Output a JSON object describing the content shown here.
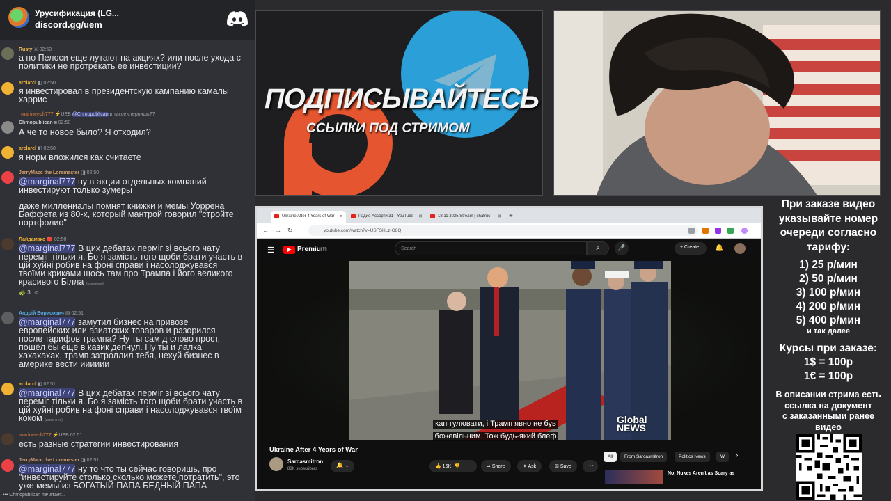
{
  "discord": {
    "server_name": "Урусификация (LG...",
    "invite": "discord.gg/uem",
    "typing": "Chmopublican печатает..."
  },
  "messages": [
    {
      "user": "Rusty",
      "time": "02:50",
      "lines": [
        "а по Пелоси еще лутают на акциях? или после ухода с",
        "политики не протрекать ее инвестиции?"
      ]
    },
    {
      "user": "arclarcl",
      "time": "02:50",
      "lines": [
        "я инвестировал в президентскую кампанию камалы",
        "харрис"
      ]
    },
    {
      "reply_user": "marineech777",
      "reply_badge": "UEB",
      "reply_mention": "@Chmopublican",
      "reply_text": "и такое стерпишь??",
      "user": "Chmopublican",
      "time": "02:50",
      "lines": [
        "А че то новое было? Я отходил?"
      ]
    },
    {
      "user": "arclarcl",
      "time": "02:50",
      "lines": [
        "я норм вложился как считаете"
      ]
    },
    {
      "user": "JerryMacc the Loremaster",
      "time": "02:50",
      "mention": "@marginal777",
      "lines": [
        " ну в акции отдельных компаний",
        "инвестируют только зумеры"
      ]
    },
    {
      "lines": [
        "даже миллениалы помнят книжки и мемы Уоррена",
        "Баффета из 80-х, который мантрой говорил \"стройте",
        "портфолио\""
      ]
    },
    {
      "user": "Лайдамако",
      "time": "02:50",
      "mention": "@marginal777",
      "lines": [
        " В циx дебатах перміг зі всього чату",
        "переміг тільки я. Бо я замість того щоби брати участь в",
        "цій хуйні робив на фоні справи і насолоджувався",
        "твоїми криками щось там про Трампа і його великого",
        "красивого Білла"
      ],
      "edited": "(изменено)",
      "reacts": "3"
    },
    {
      "user": "Андрій Борисович",
      "time": "02:51",
      "mention": "@marginal777",
      "lines": [
        " замутил бизнес на привозе",
        "европейских или азиатских товаров и разорился",
        "после тарифов трампа? Ну ты сам д слово прост,",
        "пошёл бы ещё в казик депнул. Ну ты и лалка",
        "хахахахах, трамп затроллил тебя, нехуй бизнес в",
        "америке вести ииииии"
      ]
    },
    {
      "user": "arclarcl",
      "time": "02:51",
      "mention": "@marginal777",
      "lines": [
        " В циx дебатах перміг зі всього чату",
        "переміг тільки я. Бо я замість того щоби брати участь в",
        "цій хуйні робив на фоні справи і насолоджувався твоїм",
        "коком"
      ],
      "edited": "(изменено)"
    },
    {
      "user": "marineech777",
      "badge": "UEB",
      "time": "02:51",
      "lines": [
        "есть разные стратегии инвестирования"
      ]
    },
    {
      "user": "JerryMacc the Loremaster",
      "time": "02:51",
      "mention": "@marginal777",
      "lines": [
        " ну то что ты сейчас говоришь, про",
        "\"инвестируйте столько сколько можете потратить\", это",
        "уже мемы из БОГАТЫЙ ПАПА БЕДНЫЙ ПАПА"
      ]
    }
  ],
  "promo": {
    "title": "ПОДПИСЫВАЙТЕСЬ",
    "subtitle": "ССЫЛКИ ПОД СТРИМОМ"
  },
  "browser": {
    "tabs": [
      "Ukraine After 4 Years of War",
      "Радио Ассорти 31 · YouTube",
      "18 11 2025 Stream | chatruc"
    ],
    "url": "youtube.com/watch?v=USFSHLz-O8Q"
  },
  "youtube": {
    "brand": "Premium",
    "search_placeholder": "Search",
    "create_label": "Create",
    "subtitle_lines": [
      "капітулювати, і Трамп явно не був",
      "божевільним.  Тож будь-який блеф"
    ],
    "watermark": [
      "Global",
      "NEWS"
    ],
    "video_title": "Ukraine After 4 Years of War",
    "channel": "Sarcasmitron",
    "channel_subs": "83K subscribers",
    "likes": "16K",
    "share_label": "Share",
    "ask_label": "Ask",
    "save_label": "Save",
    "chips": [
      "All",
      "From Sarcasmitron",
      "Politics News",
      "W"
    ],
    "rec_title": "No, Nukes Aren't as Scary as"
  },
  "info": {
    "order_lines": [
      "При заказе видео",
      "указывайте номер",
      "очереди согласно",
      "тарифу:"
    ],
    "tariffs": [
      "1) 25 р/мин",
      "2) 50 р/мин",
      "3) 100 р/мин",
      "4) 200 р/мин",
      "5) 400 р/мин"
    ],
    "tariffs_more": "и так далее",
    "rates_title": "Курсы при заказе:",
    "rates": [
      "1$ = 100р",
      "1€ = 100р"
    ],
    "desc_lines": [
      "В описании стрима есть",
      "ссылка на документ",
      "с заказанными ранее",
      "видео"
    ]
  },
  "colors": {
    "discord_bg": "#2f3136",
    "mention_bg": "#5865f2",
    "yt_red": "#ff0000",
    "telegram_blue": "#2a9fd8",
    "patreon_orange": "#e5552f"
  }
}
